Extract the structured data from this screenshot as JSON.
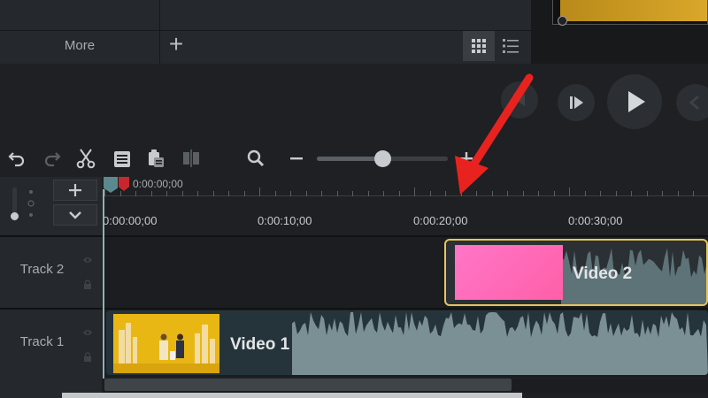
{
  "library": {
    "more_label": "More",
    "add_symbol": "+"
  },
  "timeline": {
    "playhead_time": "0:00:00;00",
    "ruler_labels": [
      "0:00:00;00",
      "0:00:10;00",
      "0:00:20;00",
      "0:00:30;00"
    ]
  },
  "tracks": [
    {
      "name": "Track 2",
      "clip_title": "Video 2"
    },
    {
      "name": "Track 1",
      "clip_title": "Video 1"
    }
  ],
  "zoom": {
    "level": 0.5
  },
  "colors": {
    "accent_clip_border": "#e7c45b",
    "playhead_red": "#c8282d",
    "clip2_fill": "#ff6fbe",
    "clip1_thumb": "#e7b612",
    "annotation_arrow": "#e8231f"
  },
  "icons": {
    "undo": "undo-icon",
    "redo": "redo-icon",
    "cut": "scissors-icon",
    "copy": "copy-icon",
    "paste": "paste-icon",
    "split": "split-icon",
    "zoom": "search-icon",
    "zoom_out": "minus-icon",
    "zoom_in": "plus-icon",
    "grid_view": "grid-view-icon",
    "list_view": "list-view-icon",
    "eye": "eye-icon",
    "lock": "lock-icon"
  }
}
